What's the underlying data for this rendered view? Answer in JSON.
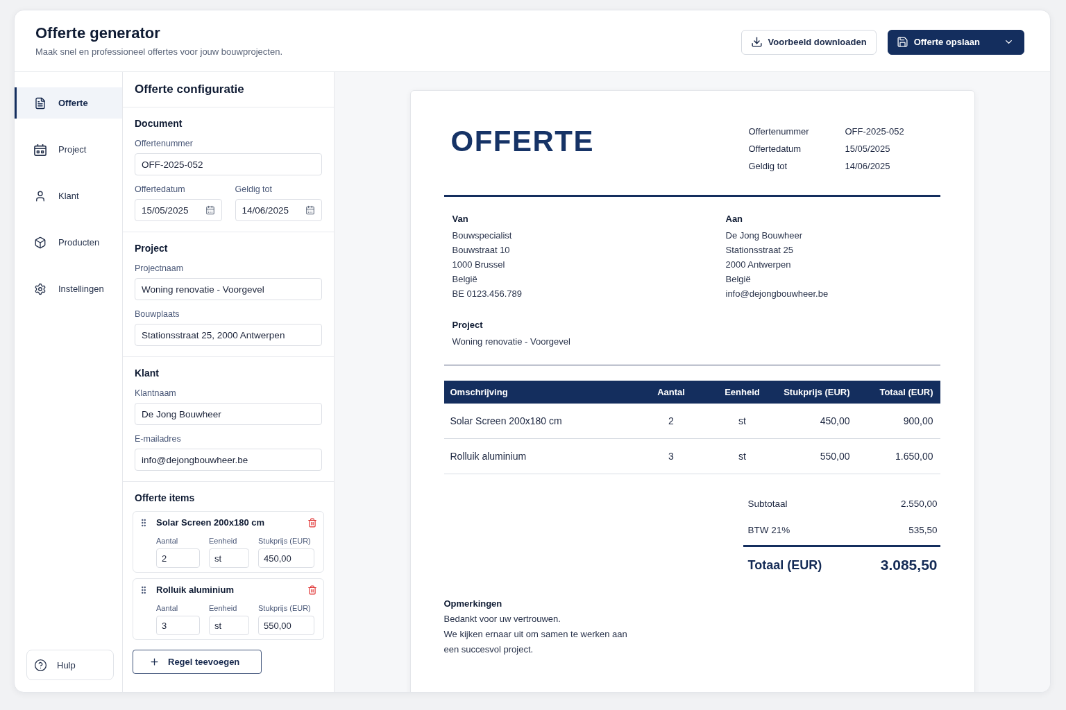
{
  "header": {
    "title": "Offerte generator",
    "subtitle": "Maak snel en professioneel offertes voor jouw bouwprojecten.",
    "actions": [
      {
        "label": "Voorbeeld downloaden",
        "kind": "secondary"
      },
      {
        "label": "Offerte opslaan",
        "kind": "primary"
      }
    ]
  },
  "sidebar": {
    "items": [
      {
        "label": "Offerte",
        "selected": true
      },
      {
        "label": "Project",
        "selected": false
      },
      {
        "label": "Klant",
        "selected": false
      },
      {
        "label": "Producten",
        "selected": false
      },
      {
        "label": "Instellingen",
        "selected": false
      }
    ],
    "help": {
      "label": "Hulp"
    }
  },
  "config": {
    "title": "Offerte configuratie",
    "sections": [
      {
        "title": "Document",
        "fields": [
          {
            "label": "Offertenummer",
            "value": "OFF-2025-052",
            "kind": "text"
          },
          {
            "label": "Offertedatum",
            "value": "15/05/2025",
            "kind": "date"
          },
          {
            "label": "Geldig tot",
            "value": "14/06/2025",
            "kind": "date"
          }
        ]
      },
      {
        "title": "Project",
        "fields": [
          {
            "label": "Projectnaam",
            "value": "Woning renovatie - Voorgevel",
            "kind": "text"
          },
          {
            "label": "Bouwplaats",
            "value": "Stationsstraat 25, 2000 Antwerpen",
            "kind": "text"
          }
        ]
      },
      {
        "title": "Klant",
        "fields": [
          {
            "label": "Klantnaam",
            "value": "De Jong Bouwheer",
            "kind": "text"
          },
          {
            "label": "E-mailadres",
            "value": "info@dejongbouwheer.be",
            "kind": "text"
          }
        ]
      }
    ],
    "items_section": {
      "title": "Offerte items",
      "items": [
        {
          "name": "Solar Screen 200x180 cm",
          "fields": [
            {
              "label": "Aantal",
              "value": "2"
            },
            {
              "label": "Eenheid",
              "value": "st"
            },
            {
              "label": "Stukprijs (EUR)",
              "value": "450,00"
            }
          ]
        },
        {
          "name": "Rolluik aluminium",
          "fields": [
            {
              "label": "Aantal",
              "value": "3"
            },
            {
              "label": "Eenheid",
              "value": "st"
            },
            {
              "label": "Stukprijs (EUR)",
              "value": "550,00"
            }
          ]
        }
      ],
      "add_button": {
        "label": "Regel teevoegen"
      }
    }
  },
  "preview": {
    "title": "OFFERTE",
    "meta": [
      {
        "label": "Offertenummer",
        "value": "OFF-2025-052"
      },
      {
        "label": "Offertedatum",
        "value": "15/05/2025"
      },
      {
        "label": "Geldig tot",
        "value": "14/06/2025"
      }
    ],
    "parties": [
      {
        "heading": "Van",
        "lines": [
          "Bouwspecialist",
          "Bouwstraat 10",
          "1000 Brussel",
          "België",
          "BE 0123.456.789"
        ]
      },
      {
        "heading": "Aan",
        "lines": [
          "De Jong Bouwheer",
          "Stationsstraat 25",
          "2000 Antwerpen",
          "België",
          "info@dejongbouwheer.be"
        ]
      }
    ],
    "project": {
      "heading": "Project",
      "value": "Woning renovatie - Voorgevel"
    },
    "table": {
      "columns": [
        "Omschrijving",
        "Aantal",
        "Eenheid",
        "Stukprijs (EUR)",
        "Totaal (EUR)"
      ],
      "rows": [
        [
          "Solar Screen 200x180 cm",
          "2",
          "st",
          "450,00",
          "900,00"
        ],
        [
          "Rolluik aluminium",
          "3",
          "st",
          "550,00",
          "1.650,00"
        ]
      ]
    },
    "totals": [
      {
        "label": "Subtotaal",
        "value": "2.550,00",
        "kind": "line"
      },
      {
        "label": "BTW 21%",
        "value": "535,50",
        "kind": "line"
      },
      {
        "label": "Totaal (EUR)",
        "value": "3.085,50",
        "kind": "grand"
      }
    ],
    "notes": {
      "heading": "Opmerkingen",
      "paragraphs": [
        "Bedankt voor uw vertrouwen.",
        "We kijken ernaar uit om samen te werken aan een succesvol project."
      ]
    }
  }
}
